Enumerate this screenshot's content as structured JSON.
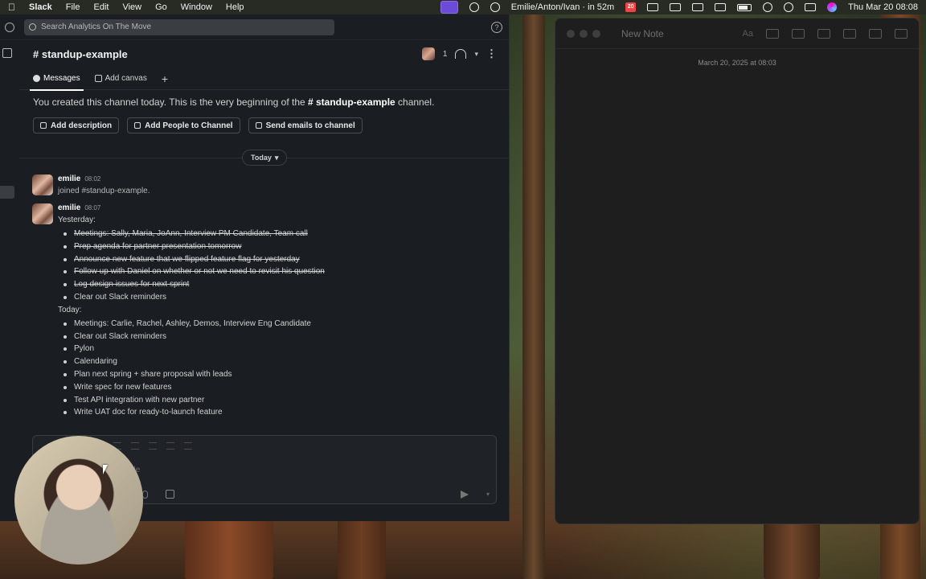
{
  "menubar": {
    "app_name": "Slack",
    "menus": [
      "File",
      "Edit",
      "View",
      "Go",
      "Window",
      "Help"
    ],
    "meeting": "Emilie/Anton/Ivan · in 52m",
    "calendar_day": "20",
    "clock": "Thu Mar 20  08:08"
  },
  "slack": {
    "search_placeholder": "Search Analytics On The Move",
    "channel_title": "# standup-example",
    "member_count": "1",
    "tabs": [
      {
        "label": "Messages"
      },
      {
        "label": "Add canvas"
      }
    ],
    "intro_prefix": "You created this channel today. This is the very beginning of the ",
    "intro_channel": "# standup-example",
    "intro_suffix": " channel.",
    "buttons": {
      "add_description": "Add description",
      "add_people": "Add People to Channel",
      "send_emails": "Send emails to channel"
    },
    "day_divider": "Today",
    "messages": [
      {
        "author": "emilie",
        "time": "08:02",
        "text": "joined #standup-example."
      },
      {
        "author": "emilie",
        "time": "08:07",
        "yesterday_label": "Yesterday:",
        "yesterday": [
          "Meetings: Sally, Maria, JoAnn, Interview PM Candidate, Team call",
          "Prep agenda for partner presentation tomorrow",
          "Announce new feature that we flipped feature flag for yesterday",
          "Follow up with Daniel on whether or not we need to revisit his question",
          "Log design issues for next sprint",
          "Clear out Slack reminders"
        ],
        "today_label": "Today:",
        "today": [
          "Meetings: Carlie, Rachel, Ashley, Demos, Interview Eng Candidate",
          "Clear out Slack reminders",
          "Pylon",
          "Calendaring",
          "Plan next spring + share proposal with leads",
          "Write spec for new features",
          "Test API integration with new partner",
          "Write UAT doc for ready-to-launch feature"
        ]
      }
    ],
    "composer_placeholder": "ple"
  },
  "notes": {
    "title": "New Note",
    "date": "March 20, 2025 at 08:03",
    "aa_label": "Aa"
  }
}
